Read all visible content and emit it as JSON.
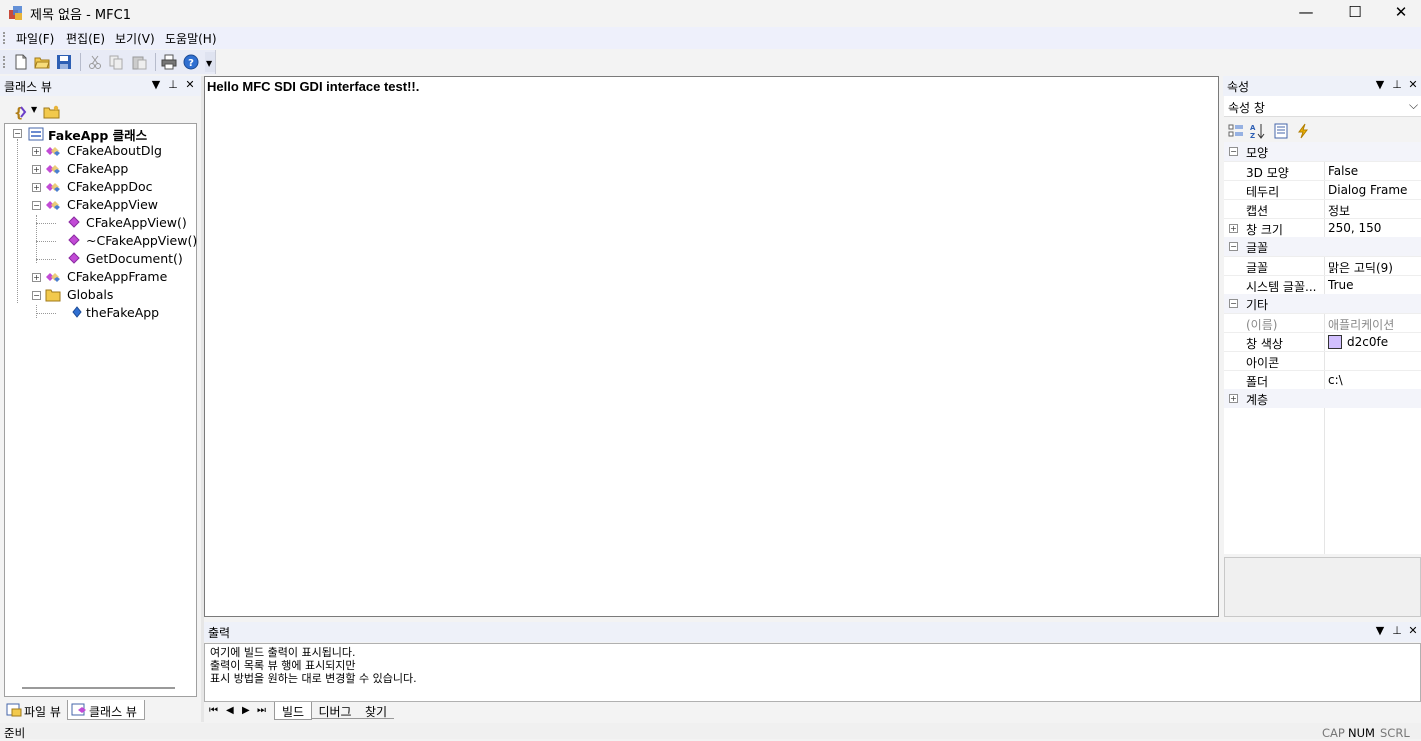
{
  "window": {
    "title": "제목 없음 - MFC1",
    "minimize_glyph": "—",
    "maximize_glyph": "☐",
    "close_glyph": "✕"
  },
  "menu": [
    "파일(F)",
    "편집(E)",
    "보기(V)",
    "도움말(H)"
  ],
  "class_view": {
    "title": "클래스 뷰",
    "root": "FakeApp 클래스",
    "items": [
      {
        "label": "CFakeAboutDlg",
        "level": 1,
        "expand": "+",
        "icon": "class-icon"
      },
      {
        "label": "CFakeApp",
        "level": 1,
        "expand": "+",
        "icon": "class-icon"
      },
      {
        "label": "CFakeAppDoc",
        "level": 1,
        "expand": "+",
        "icon": "class-icon"
      },
      {
        "label": "CFakeAppView",
        "level": 1,
        "expand": "−",
        "icon": "class-icon"
      },
      {
        "label": "CFakeAppView()",
        "level": 2,
        "expand": "",
        "icon": "method-icon"
      },
      {
        "label": "~CFakeAppView()",
        "level": 2,
        "expand": "",
        "icon": "method-icon"
      },
      {
        "label": "GetDocument()",
        "level": 2,
        "expand": "",
        "icon": "method-icon"
      },
      {
        "label": "CFakeAppFrame",
        "level": 1,
        "expand": "+",
        "icon": "class-icon"
      },
      {
        "label": "Globals",
        "level": 1,
        "expand": "−",
        "icon": "folder-icon"
      },
      {
        "label": "theFakeApp",
        "level": 2,
        "expand": "",
        "icon": "variable-icon"
      }
    ],
    "tabs": [
      "파일 뷰",
      "클래스 뷰"
    ]
  },
  "document": {
    "text": "Hello MFC SDI GDI interface test!!."
  },
  "properties": {
    "title": "속성",
    "combo_value": "속성 창",
    "categories": [
      {
        "name": "모양",
        "expanded": true,
        "rows": [
          {
            "name": "3D 모양",
            "value": "False"
          },
          {
            "name": "테두리",
            "value": "Dialog Frame"
          },
          {
            "name": "캡션",
            "value": "정보"
          },
          {
            "name": "창 크기",
            "value": "250, 150",
            "expandable": true
          }
        ]
      },
      {
        "name": "글꼴",
        "expanded": true,
        "rows": [
          {
            "name": "글꼴",
            "value": "맑은 고딕(9)"
          },
          {
            "name": "시스템 글꼴...",
            "value": "True"
          }
        ]
      },
      {
        "name": "기타",
        "expanded": true,
        "rows": [
          {
            "name": "(이름)",
            "value": "애플리케이션",
            "disabled": true
          },
          {
            "name": "창 색상",
            "value": "d2c0fe",
            "swatch": "#d2c0fe"
          },
          {
            "name": "아이콘",
            "value": ""
          },
          {
            "name": "폴더",
            "value": "c:\\"
          }
        ]
      },
      {
        "name": "계층",
        "expanded": false,
        "rows": []
      }
    ]
  },
  "output": {
    "title": "출력",
    "lines": [
      "여기에 빌드 출력이 표시됩니다.",
      "출력이 목록 뷰 행에 표시되지만",
      "표시 방법을 원하는 대로 변경할 수 있습니다."
    ],
    "tabs": [
      "빌드",
      "디버그",
      "찾기"
    ]
  },
  "statusbar": {
    "text": "준비",
    "indicators": [
      "CAP",
      "NUM",
      "SCRL"
    ]
  },
  "pane_buttons": {
    "dropdown": "▼",
    "pin": "⊥",
    "close": "✕"
  }
}
